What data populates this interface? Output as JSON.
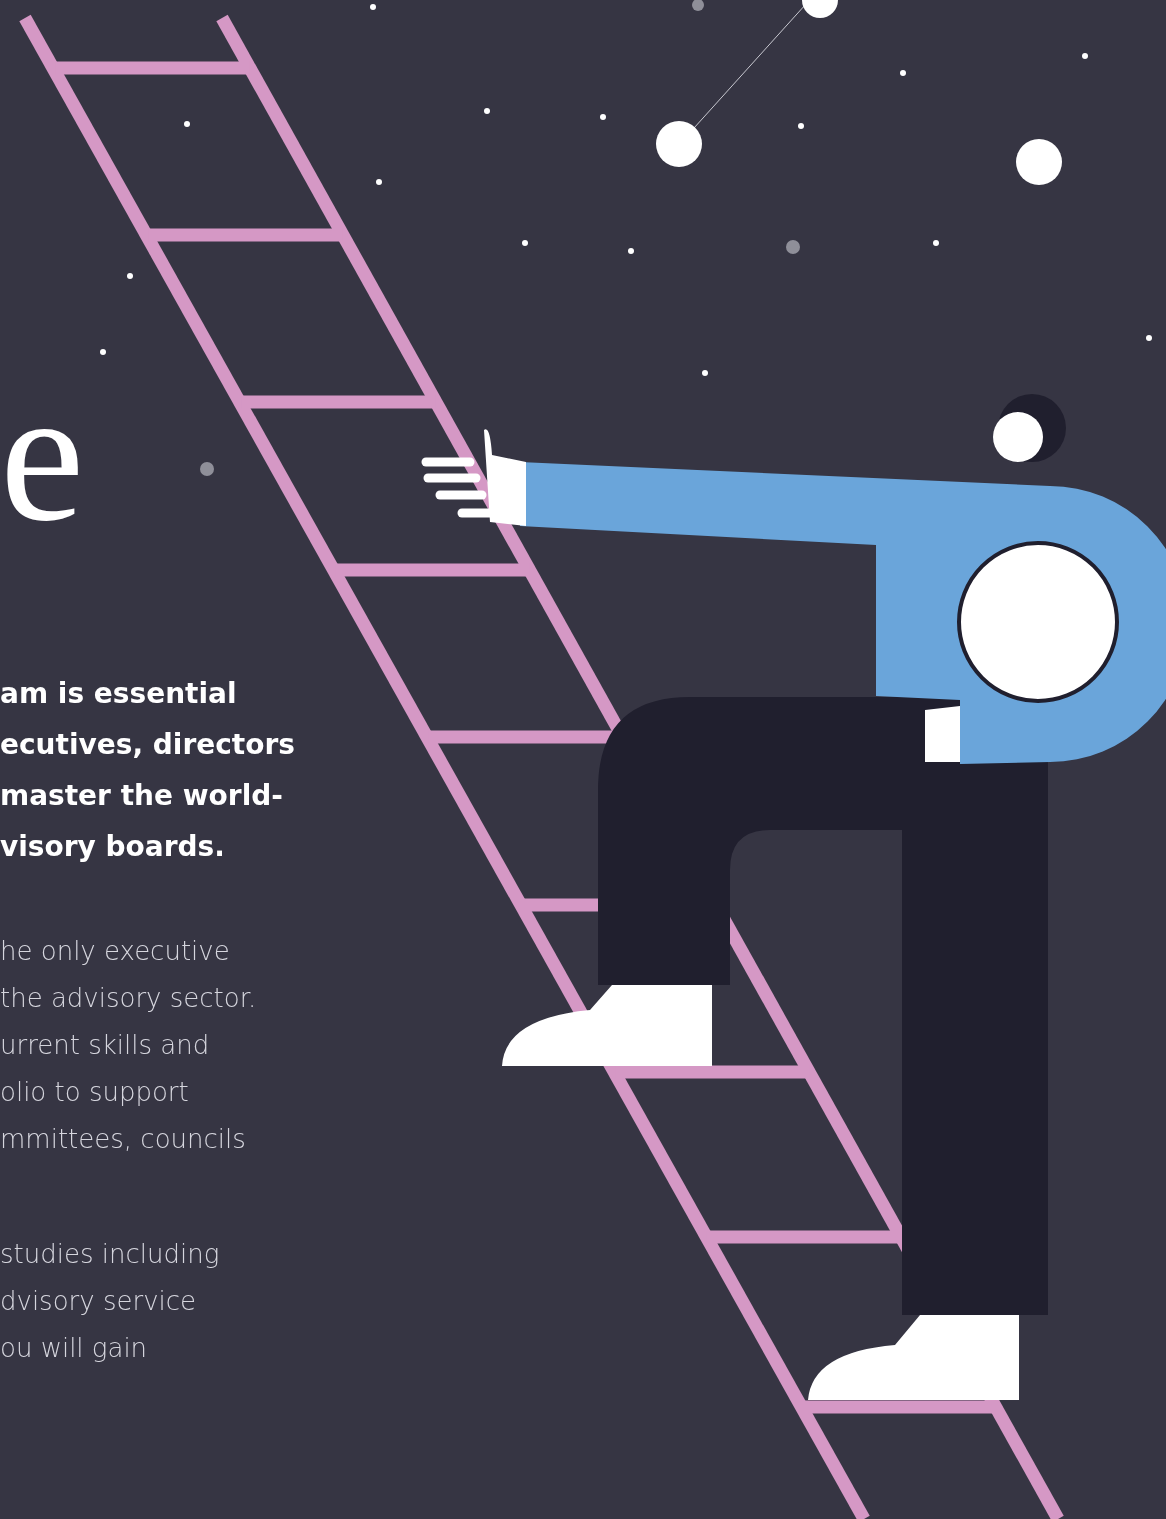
{
  "hero": {
    "letter": "e"
  },
  "heading": {
    "lines": [
      "am is essential",
      "ecutives, directors",
      "master the world-",
      "visory boards."
    ]
  },
  "paragraphs": [
    {
      "lines": [
        "he only executive",
        "the advisory sector.",
        "urrent skills and",
        "olio to support",
        "mmittees, councils"
      ]
    },
    {
      "lines": [
        "studies including",
        "dvisory service",
        "ou will gain"
      ]
    }
  ]
}
